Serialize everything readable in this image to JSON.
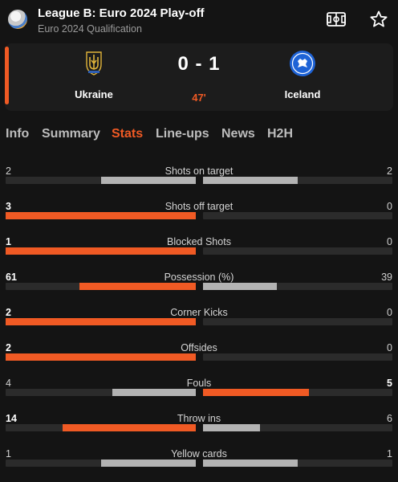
{
  "header": {
    "title": "League B: Euro 2024 Play-off",
    "subtitle": "Euro 2024 Qualification",
    "icons": {
      "competition": "euro-2024-logo",
      "pitch": "pitch-icon",
      "favorite": "star-icon"
    }
  },
  "match": {
    "home_team": "Ukraine",
    "away_team": "Iceland",
    "score": "0 - 1",
    "minute": "47'"
  },
  "tabs": [
    "Info",
    "Summary",
    "Stats",
    "Line-ups",
    "News",
    "H2H"
  ],
  "active_tab": "Stats",
  "colors": {
    "accent": "#f05a24",
    "neutral_bar": "#b3b3b3",
    "track": "#2b2b2b",
    "background": "#141414"
  },
  "stats": [
    {
      "name": "Shots on target",
      "home": "2",
      "away": "2",
      "home_frac": 0.5,
      "away_frac": 0.5,
      "leader": "none"
    },
    {
      "name": "Shots off target",
      "home": "3",
      "away": "0",
      "home_frac": 1.0,
      "away_frac": 0.0,
      "leader": "home"
    },
    {
      "name": "Blocked Shots",
      "home": "1",
      "away": "0",
      "home_frac": 1.0,
      "away_frac": 0.0,
      "leader": "home"
    },
    {
      "name": "Possession (%)",
      "home": "61",
      "away": "39",
      "home_frac": 0.61,
      "away_frac": 0.39,
      "leader": "home"
    },
    {
      "name": "Corner Kicks",
      "home": "2",
      "away": "0",
      "home_frac": 1.0,
      "away_frac": 0.0,
      "leader": "home"
    },
    {
      "name": "Offsides",
      "home": "2",
      "away": "0",
      "home_frac": 1.0,
      "away_frac": 0.0,
      "leader": "home"
    },
    {
      "name": "Fouls",
      "home": "4",
      "away": "5",
      "home_frac": 0.44,
      "away_frac": 0.56,
      "leader": "away"
    },
    {
      "name": "Throw ins",
      "home": "14",
      "away": "6",
      "home_frac": 0.7,
      "away_frac": 0.3,
      "leader": "home"
    },
    {
      "name": "Yellow cards",
      "home": "1",
      "away": "1",
      "home_frac": 0.5,
      "away_frac": 0.5,
      "leader": "none"
    }
  ]
}
